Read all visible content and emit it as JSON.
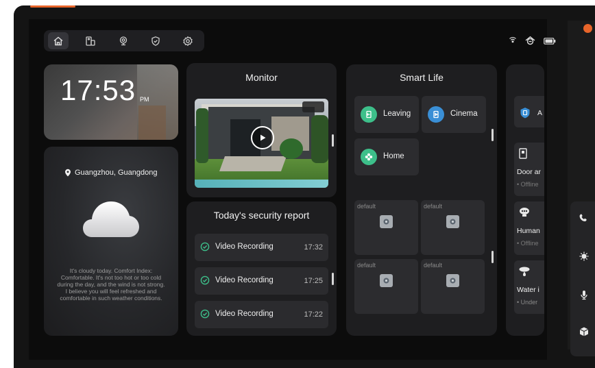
{
  "nav": {
    "items": [
      {
        "name": "home",
        "icon": "home-icon",
        "active": true
      },
      {
        "name": "devices",
        "icon": "devices-icon",
        "active": false
      },
      {
        "name": "camera",
        "icon": "camera-icon",
        "active": false
      },
      {
        "name": "security",
        "icon": "shield-icon",
        "active": false
      },
      {
        "name": "settings",
        "icon": "gear-icon",
        "active": false
      }
    ]
  },
  "status_icons": [
    "wifi-icon",
    "gateway-icon",
    "battery-icon"
  ],
  "clock": {
    "time": "17:53",
    "ampm": "PM"
  },
  "weather": {
    "location": "Guangzhou, Guangdong",
    "condition_icon": "cloud-icon",
    "description": "It's cloudy today. Comfort Index: Comfortable. It's not too hot or too cold during the day, and the wind is not strong. I believe you will feel refreshed and comfortable in such weather conditions."
  },
  "monitor": {
    "title": "Monitor"
  },
  "security_report": {
    "title": "Today's security report",
    "items": [
      {
        "label": "Video Recording",
        "time": "17:32"
      },
      {
        "label": "Video Recording",
        "time": "17:25"
      },
      {
        "label": "Video Recording",
        "time": "17:22"
      }
    ]
  },
  "smart_life": {
    "title": "Smart Life",
    "scenes": [
      {
        "label": "Leaving",
        "icon": "leaving-icon",
        "color": "#3dbf8a"
      },
      {
        "label": "Cinema",
        "icon": "cinema-icon",
        "color": "#3a8fd6"
      },
      {
        "label": "Home",
        "icon": "home-scene-icon",
        "color": "#3dbf8a"
      }
    ],
    "devices": [
      {
        "label": "default"
      },
      {
        "label": "default"
      },
      {
        "label": "default"
      },
      {
        "label": "default"
      }
    ]
  },
  "right_panel": {
    "cards": [
      {
        "name": "A",
        "status": "",
        "icon": "shield-blue-icon"
      },
      {
        "name": "Door ar",
        "status": "• Offline",
        "icon": "door-sensor-icon"
      },
      {
        "name": "Human",
        "status": "• Offline",
        "icon": "human-sensor-icon"
      },
      {
        "name": "Water i",
        "status": "• Under",
        "icon": "water-sensor-icon"
      }
    ]
  },
  "side_icons": [
    "phone-icon",
    "light-icon",
    "microphone-icon",
    "cube-icon"
  ],
  "colors": {
    "accent_orange": "#e8652a",
    "scene_green": "#3dbf8a",
    "scene_blue": "#3a8fd6",
    "status_green": "#3dbf8a"
  }
}
